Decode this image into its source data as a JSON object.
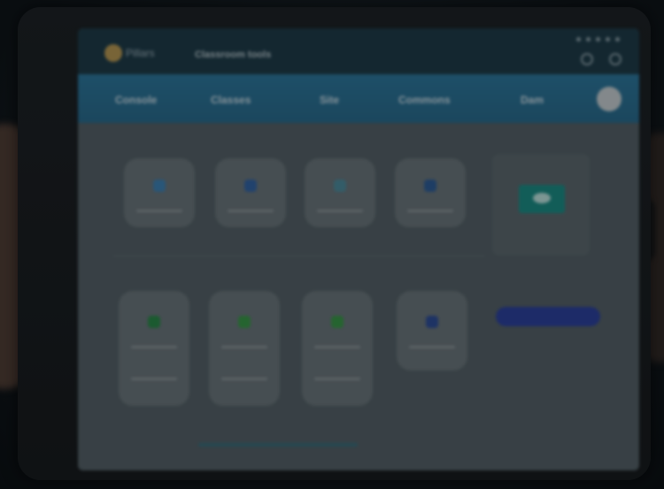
{
  "topbar": {
    "brand": "Pillars",
    "title": "Classroom tools"
  },
  "navbar": {
    "items": [
      "Console",
      "Classes",
      "Site",
      "Commons",
      "Dam"
    ]
  },
  "button": {
    "label": ""
  },
  "colors": {
    "nav": "#2e7aa0",
    "accent": "#1d8f88",
    "button": "#2d43a0"
  }
}
